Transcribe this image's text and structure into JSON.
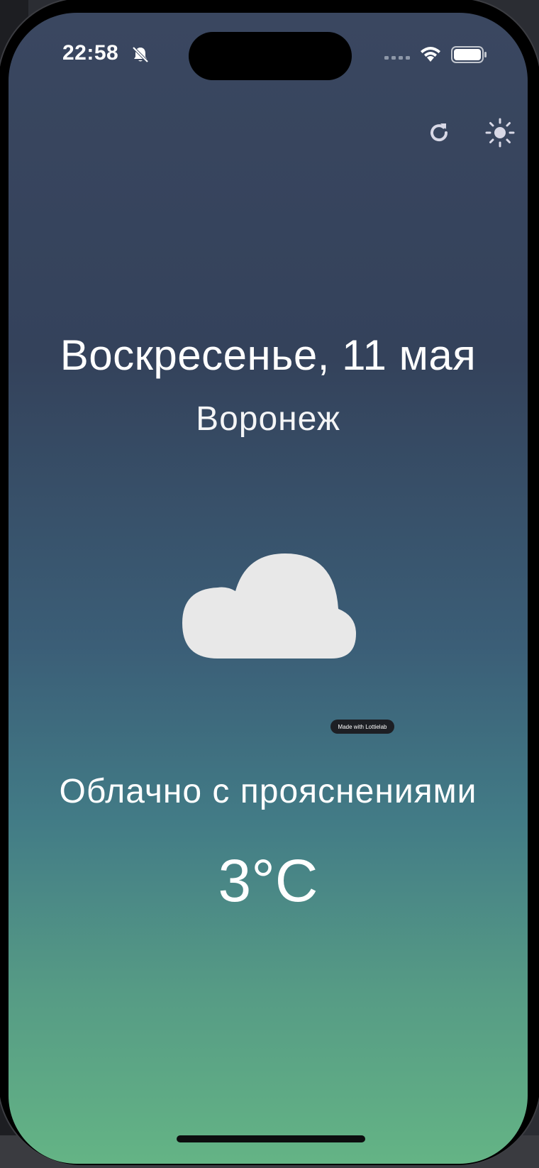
{
  "status_bar": {
    "time": "22:58",
    "icons": [
      "bell-slash-icon",
      "signal-icon",
      "wifi-icon",
      "battery-icon"
    ]
  },
  "toolbar": {
    "refresh_icon": "refresh-icon",
    "theme_icon": "sun-icon"
  },
  "weather": {
    "date": "Воскресенье, 11 мая",
    "city": "Воронеж",
    "animation_icon": "cloud-icon",
    "badge": "Made with Lottielab",
    "condition": "Облачно с прояснениями",
    "temperature": "3°C"
  },
  "colors": {
    "gradient_top": "#3a4760",
    "gradient_bottom": "#64b485",
    "text": "#ffffff",
    "icon": "#d8d8e6",
    "cloud": "#e8e8e8"
  }
}
